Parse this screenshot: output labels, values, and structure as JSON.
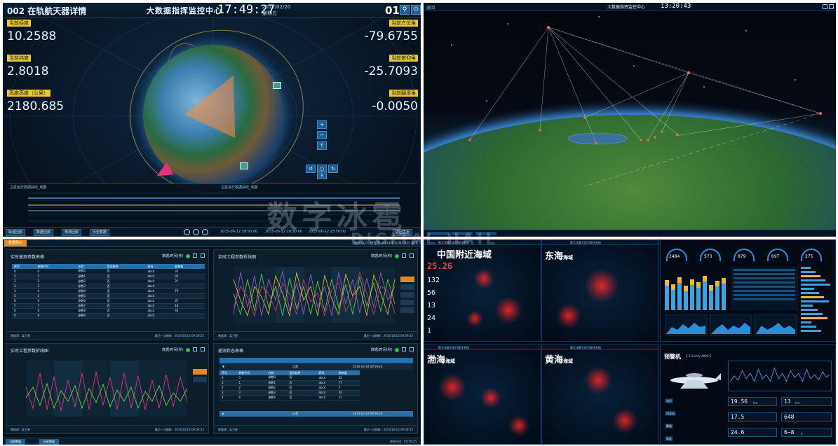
{
  "tl": {
    "title": "002 在轨航天器详情",
    "center_title": "大数据指挥监控中心",
    "time": "17:49:27",
    "date": "2017/02/20",
    "weekday": "星期五",
    "day_badge": "01",
    "m1_label": "当前经度",
    "m1_value": "10.2588",
    "m2_label": "当前纬度",
    "m2_value": "2.8018",
    "m3_label": "高度高度（公里）",
    "m3_value": "2180.685",
    "m4_label": "当前方位角",
    "m4_value": "-79.6755",
    "m5_label": "当前俯仰角",
    "m5_value": "-25.7093",
    "m6_label": "当前翻滚角",
    "m6_value": "-0.0050",
    "chart1_title": "卫星运行数据曲线_线图",
    "chart2_title": "卫星运行数据曲线_线图",
    "foot_btn1": "轨迹回放",
    "foot_btn2": "数据回放",
    "foot_btn3": "预测回放",
    "foot_btn4": "历史数据",
    "foot_time1": "2015-06-12 20:50:00",
    "foot_time2": "2015-06-12 20:50:00",
    "foot_time3": "2015-06-12 23:50:00",
    "foot_btn5": "返回主页"
  },
  "tr": {
    "hdr_left": "返回",
    "title": "大数据指挥监控中心",
    "time": "13:20:43"
  },
  "bl": {
    "tab": "数据展示",
    "top_right": "当前用户: 管理员    2014年10月14日    退出",
    "card1_title": "实时遥测参数表格",
    "card2_title": "实时工程参数折线图",
    "card3_title": "实时工程参数折线图",
    "card4_title": "遥测状态表格",
    "legend": "数据/时间(秒)",
    "foot_left": "数据源：某卫星",
    "foot_right": "最后一次刷新：2014/10/14 09:59:25",
    "table_headers": [
      "序号",
      "参数代号",
      "名称",
      "是否越界",
      "原码",
      "参数值"
    ],
    "table_rows": [
      [
        "0",
        "0",
        "参数0",
        "否",
        "abcd",
        "37"
      ],
      [
        "1",
        "1",
        "参数1",
        "否",
        "abcd",
        "35"
      ],
      [
        "2",
        "2",
        "参数2",
        "否",
        "abcd",
        "21"
      ],
      [
        "3",
        "3",
        "参数3",
        "否",
        "abcd",
        ""
      ],
      [
        "4",
        "4",
        "参数4",
        "否",
        "abcd",
        "79"
      ],
      [
        "5",
        "5",
        "参数5",
        "否",
        "abcd",
        ""
      ],
      [
        "6",
        "6",
        "参数6",
        "否",
        "abcd",
        "37"
      ],
      [
        "7",
        "7",
        "参数7",
        "否",
        "abcd",
        "18"
      ],
      [
        "8",
        "8",
        "参数8",
        "否",
        "abcd",
        "46"
      ],
      [
        "9",
        "9",
        "参数9",
        "否",
        "abcd",
        ""
      ]
    ],
    "status_rows": [
      [
        "0",
        "0",
        "参数0",
        "否",
        "abcd",
        "42"
      ],
      [
        "1",
        "1",
        "参数1",
        "否",
        "abcd",
        "77"
      ],
      [
        "2",
        "2",
        "参数2",
        "否",
        "abcd",
        "7"
      ],
      [
        "3",
        "3",
        "参数3",
        "否",
        "abcd",
        "56"
      ],
      [
        "4",
        "4",
        "参数4",
        "否",
        "abcd",
        "21"
      ]
    ],
    "status_group1": "正常",
    "status_time1": "2014-10-14 09:59:23",
    "status_group2": "正常",
    "status_time2": "2014-10-14 09:59:23",
    "bottom_btn1": "当前数据",
    "bottom_btn2": "历史数据",
    "bottom_right": "更新时间：09:59:25"
  },
  "br": {
    "map1_hdr": "数字冰雹大屏可视化系统",
    "sea1": "中国附近海域",
    "red_value": "25.26",
    "n1": "132",
    "n2": "56",
    "n3": "13",
    "n4": "24",
    "n5": "1",
    "sea2": "东海",
    "sea2_suffix": "海域",
    "sea3": "渤海",
    "sea3_suffix": "海域",
    "sea4": "黄海",
    "sea4_suffix": "海域",
    "gauge_vals": [
      "2484",
      "573",
      "879",
      "697",
      "275"
    ],
    "warn_title": "预警机",
    "warn_sub": "E-3 Sentry AWACS",
    "kv1": "19.56",
    "kv2": "17.5",
    "kv3": "24.6",
    "kv4": "13",
    "kv5": "648",
    "kv6": "6~8",
    "kv1_unit": "km",
    "kv4_unit": "km",
    "kv6_unit": "h",
    "row1": "机型",
    "row2": "机身长",
    "row3": "翼展",
    "row4": "高度"
  },
  "watermark": "数字冰雹",
  "watermark_en": "DIGITAL HAIL",
  "colors": {
    "accent_blue": "#2c6fa5",
    "highlight_yellow": "#e7c735",
    "alert_red": "#ff3b3b",
    "tab_orange": "#e58a1e",
    "ok_green": "#27c24c"
  }
}
